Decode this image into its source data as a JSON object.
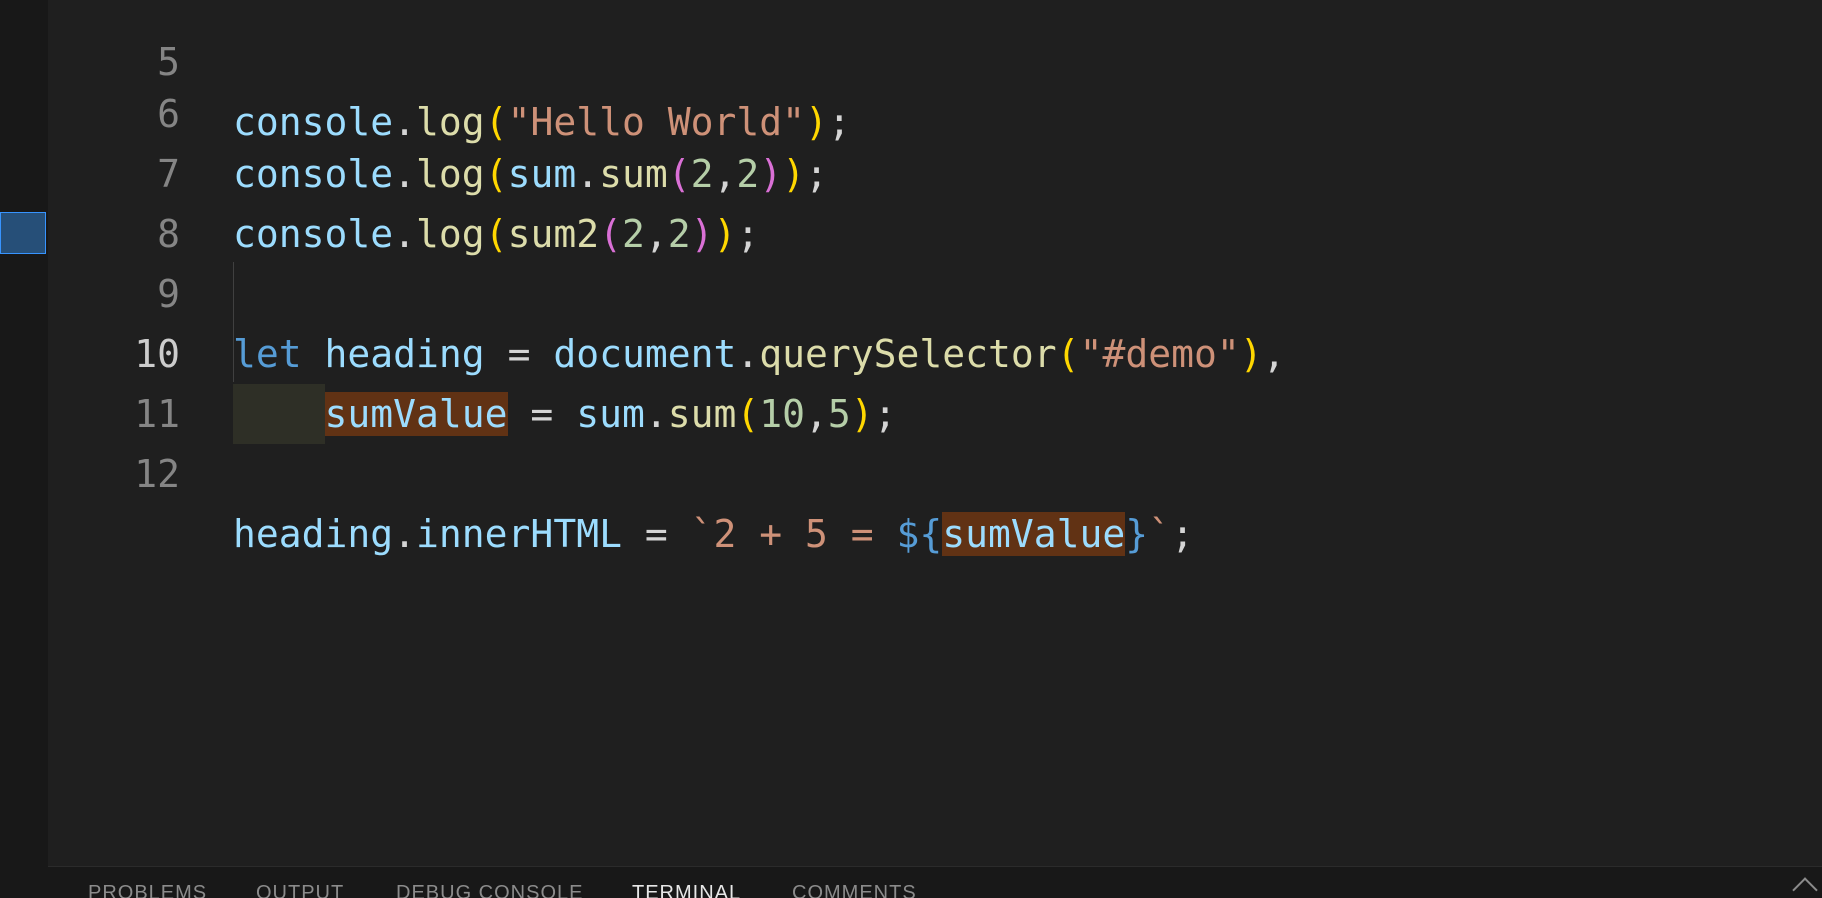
{
  "colors": {
    "background": "#1f1f1f",
    "keyword": "#569cd6",
    "variable": "#9cdcfe",
    "function": "#dcdcaa",
    "string": "#ce9178",
    "number": "#b5cea8",
    "bracket_level1": "#ffd700",
    "bracket_level2": "#da70d6",
    "highlight": "#613214"
  },
  "editor": {
    "lines": [
      {
        "number": "5",
        "text": "console.log(\"Hello World\");"
      },
      {
        "number": "6",
        "text": "console.log(sum.sum(2,2));"
      },
      {
        "number": "7",
        "text": "console.log(sum2(2,2));"
      },
      {
        "number": "8",
        "text": ""
      },
      {
        "number": "9",
        "text": "let heading = document.querySelector(\"#demo\"),"
      },
      {
        "number": "10",
        "text": "    sumValue = sum.sum(10,5);"
      },
      {
        "number": "11",
        "text": ""
      },
      {
        "number": "12",
        "text": "heading.innerHTML = `2 + 5 = ${sumValue}`;"
      }
    ],
    "active_line": "10",
    "highlighted_symbol": "sumValue"
  },
  "panel": {
    "tabs": [
      {
        "label": "PROBLEMS",
        "active": false
      },
      {
        "label": "OUTPUT",
        "active": false
      },
      {
        "label": "DEBUG CONSOLE",
        "active": false
      },
      {
        "label": "TERMINAL",
        "active": true
      },
      {
        "label": "COMMENTS",
        "active": false
      }
    ],
    "maximize_icon": "chevron-up-icon"
  }
}
